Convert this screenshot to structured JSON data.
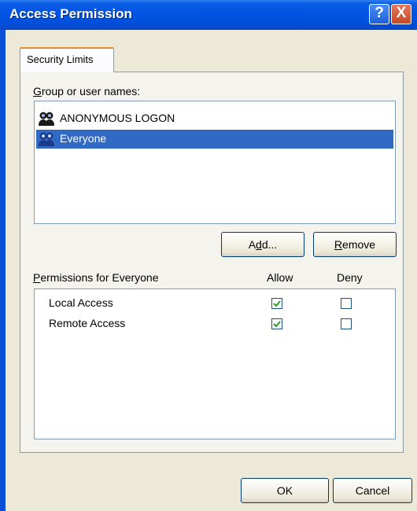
{
  "window": {
    "title": "Access Permission"
  },
  "titlebar_buttons": {
    "help": "?",
    "close": "X"
  },
  "tabs": [
    {
      "label": "Security Limits"
    }
  ],
  "groups": {
    "label": "Group or user names:",
    "items": [
      {
        "name": "ANONYMOUS LOGON",
        "icon": "users-icon",
        "selected": false
      },
      {
        "name": "Everyone",
        "icon": "users-icon",
        "selected": true
      }
    ]
  },
  "buttons": {
    "add": {
      "pre": "A",
      "mnemonic": "d",
      "post": "d..."
    },
    "remove": {
      "pre": "",
      "mnemonic": "R",
      "post": "emove"
    }
  },
  "permissions": {
    "label": "Permissions for Everyone",
    "columns": {
      "allow": "Allow",
      "deny": "Deny"
    },
    "rows": [
      {
        "name": "Local Access",
        "allow": true,
        "deny": false
      },
      {
        "name": "Remote Access",
        "allow": true,
        "deny": false
      }
    ]
  },
  "dialog_buttons": {
    "ok": "OK",
    "cancel": "Cancel"
  },
  "colors": {
    "titlebar": "#0054e3",
    "selection": "#316ac5",
    "check": "#21a121",
    "face": "#ece9d8"
  }
}
